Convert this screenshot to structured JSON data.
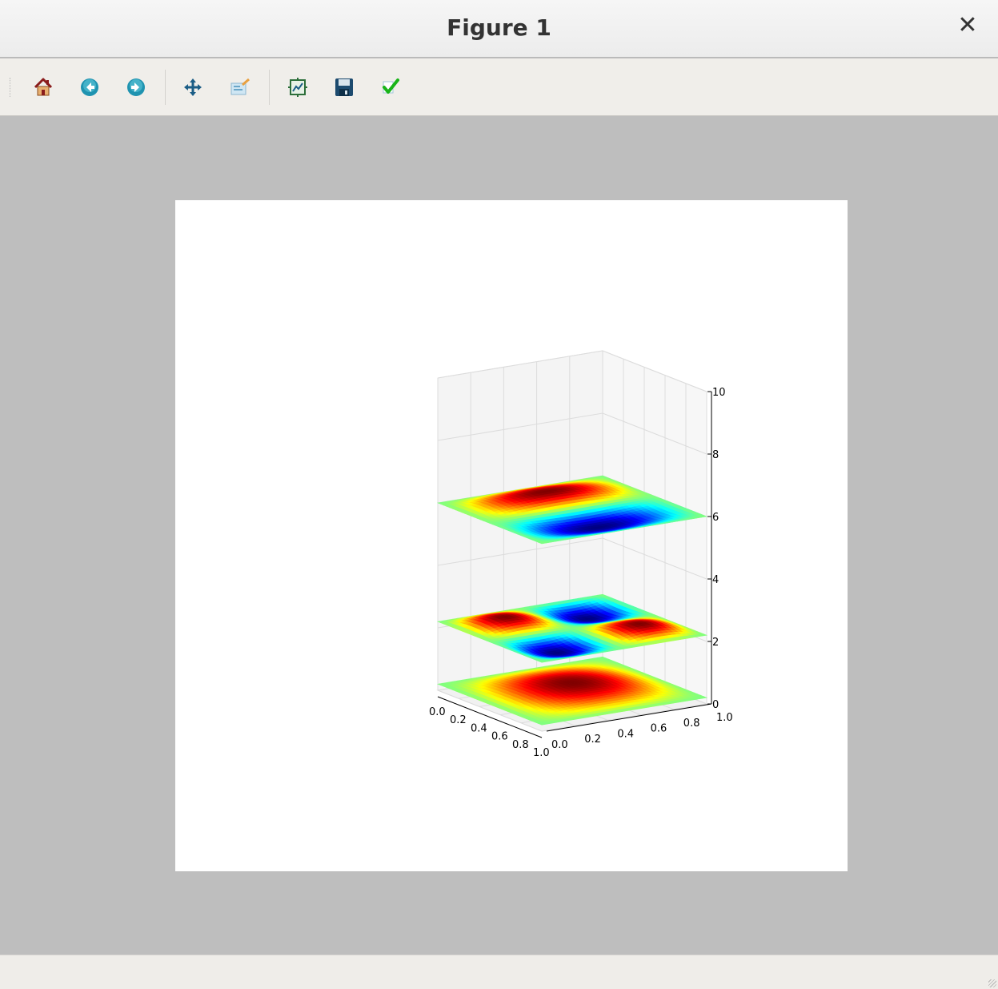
{
  "window": {
    "title": "Figure 1",
    "close_glyph": "✕"
  },
  "toolbar": {
    "buttons": [
      {
        "name": "home-button",
        "icon": "home-icon"
      },
      {
        "name": "back-button",
        "icon": "back-arrow-icon"
      },
      {
        "name": "forward-button",
        "icon": "forward-arrow-icon"
      },
      {
        "name": "pan-button",
        "icon": "move-arrows-icon"
      },
      {
        "name": "zoom-button",
        "icon": "zoom-rect-icon"
      },
      {
        "name": "subplots-button",
        "icon": "subplots-icon"
      },
      {
        "name": "save-button",
        "icon": "floppy-disk-icon"
      },
      {
        "name": "edit-button",
        "icon": "checkmark-icon"
      }
    ]
  },
  "chart_data": {
    "type": "3d-surface",
    "title": "",
    "colormap": "jet",
    "z_ticks": [
      "0",
      "2",
      "4",
      "6",
      "8",
      "10"
    ],
    "x_ticks": [
      "0.0",
      "0.2",
      "0.4",
      "0.6",
      "0.8",
      "1.0"
    ],
    "y_ticks": [
      "0.0",
      "0.2",
      "0.4",
      "0.6",
      "0.8",
      "1.0"
    ],
    "xlim": [
      0,
      1
    ],
    "ylim": [
      0,
      1
    ],
    "zlim": [
      0,
      10
    ],
    "series": [
      {
        "z_offset": 0.2,
        "mode": [
          1,
          1
        ]
      },
      {
        "z_offset": 2.2,
        "mode": [
          2,
          2
        ]
      },
      {
        "z_offset": 6.0,
        "mode": [
          2,
          1
        ]
      }
    ]
  }
}
